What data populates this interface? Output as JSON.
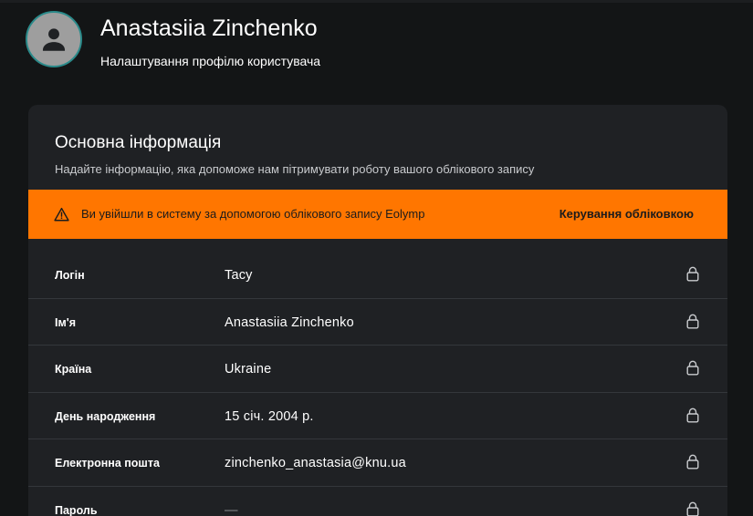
{
  "header": {
    "user_name": "Anastasiia Zinchenko",
    "subtitle": "Налаштування профілю користувача",
    "avatar_icon": "person-icon"
  },
  "card": {
    "title": "Основна інформація",
    "description": "Надайте інформацію, яка допоможе нам пітримувати роботу вашого облікового запису"
  },
  "alert": {
    "icon": "warning-icon",
    "message": "Ви увійшли в систему за допомогою облікового запису Eolymp",
    "action_label": "Керування обліковкою",
    "color": "#ff7600"
  },
  "fields": [
    {
      "label": "Логін",
      "value": "Tacy",
      "icon": "lock-icon"
    },
    {
      "label": "Ім'я",
      "value": "Anastasiia Zinchenko",
      "icon": "lock-icon"
    },
    {
      "label": "Країна",
      "value": "Ukraine",
      "icon": "lock-icon"
    },
    {
      "label": "День народження",
      "value": "15 січ. 2004 р.",
      "icon": "lock-icon"
    },
    {
      "label": "Електронна пошта",
      "value": "zinchenko_anastasia@knu.ua",
      "icon": "lock-icon"
    },
    {
      "label": "Пароль",
      "value": "—",
      "icon": "lock-icon"
    }
  ]
}
